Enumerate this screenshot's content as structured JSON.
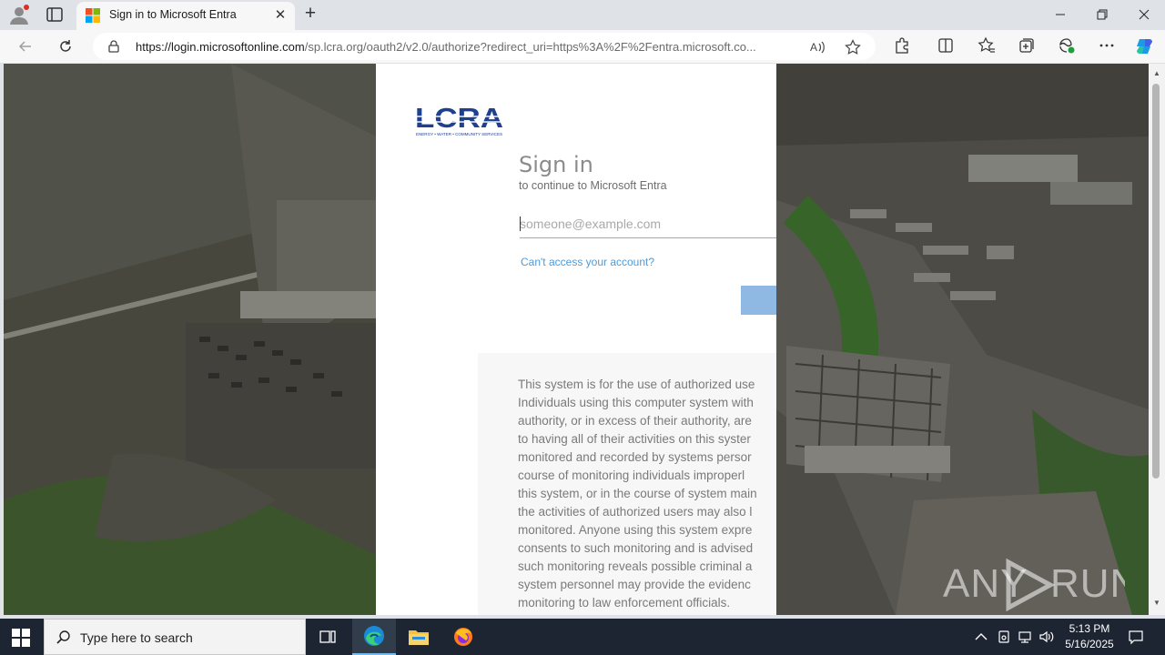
{
  "browser": {
    "tab": {
      "title": "Sign in to Microsoft Entra"
    },
    "address": {
      "host": "https://login.microsoftonline.com",
      "path": "/sp.lcra.org/oauth2/v2.0/authorize?redirect_uri=https%3A%2F%2Fentra.microsoft.co..."
    },
    "icons": [
      "profile-icon",
      "tab-actions-icon",
      "back-icon",
      "refresh-icon",
      "lock-icon",
      "read-aloud-icon",
      "favorite-icon",
      "extensions-icon",
      "split-screen-icon",
      "favorites-icon",
      "collections-icon",
      "browser-essentials-icon",
      "more-icon",
      "copilot-icon"
    ]
  },
  "signin": {
    "logo_text": "LCRA",
    "logo_tagline": "ENERGY • WATER • COMMUNITY SERVICES",
    "heading": "Sign in",
    "subheading": "to continue to Microsoft Entra",
    "email_placeholder": "someone@example.com",
    "cant_access": "Can't access your account?",
    "notice_lines": [
      "This system is for the use of authorized use",
      "Individuals using this computer system with",
      "authority, or in excess of their authority, are",
      "to having all of their activities on this syster",
      "monitored and recorded by systems persor",
      "course of monitoring individuals improperl",
      "this system, or in the course of system main",
      "the activities of authorized users may also l",
      "monitored. Anyone using this system expre",
      "consents to such monitoring and is advised",
      "such monitoring reveals possible criminal a",
      "system personnel may provide the evidenc",
      "monitoring to law enforcement officials."
    ]
  },
  "watermark": "ANY RUN",
  "taskbar": {
    "search_placeholder": "Type here to search",
    "time": "5:13 PM",
    "date": "5/16/2025"
  },
  "colors": {
    "link": "#4f9ad7",
    "next_button": "#8fb9e3",
    "logo": "#1f3f8f",
    "taskbar": "#1c2531"
  }
}
